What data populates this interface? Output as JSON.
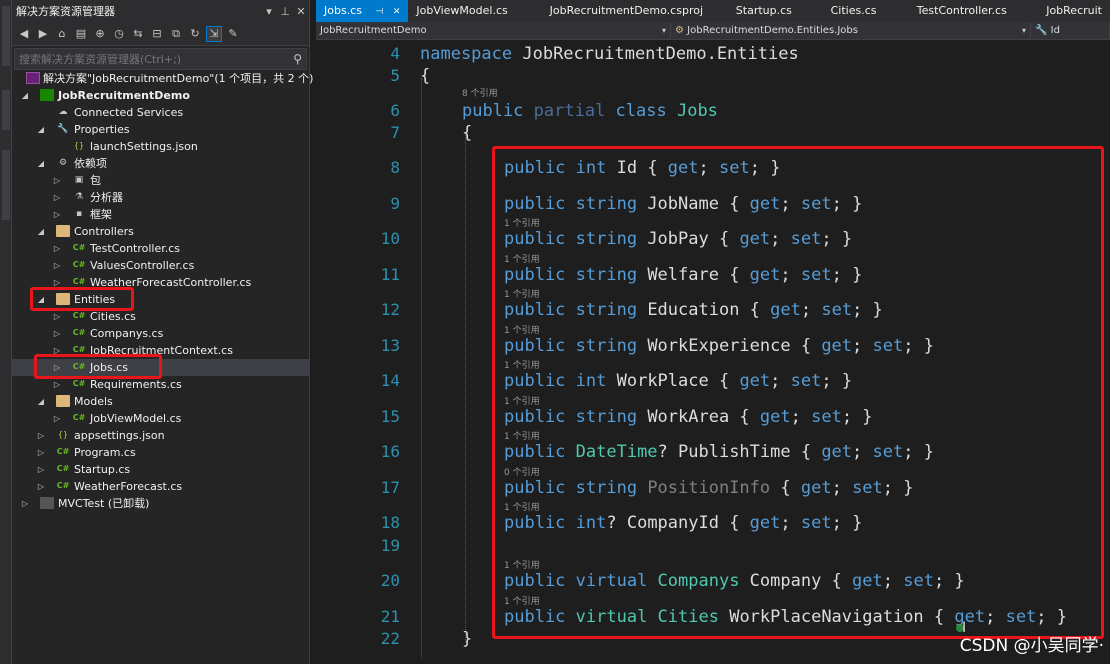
{
  "explorer": {
    "title": "解决方案资源管理器",
    "search_placeholder": "搜索解决方案资源管理器(Ctrl+;)",
    "tree": [
      {
        "label": "解决方案\"JobRecruitmentDemo\"(1 个项目，共 2 个)",
        "icon": "solution-icon"
      },
      {
        "label": "JobRecruitmentDemo",
        "icon": "csharp-project-icon"
      },
      {
        "label": "Connected Services",
        "icon": "connected-services-icon"
      },
      {
        "label": "Properties",
        "icon": "properties-icon"
      },
      {
        "label": "launchSettings.json",
        "icon": "json-file-icon"
      },
      {
        "label": "依赖项",
        "icon": "dependencies-icon"
      },
      {
        "label": "包",
        "icon": "package-icon"
      },
      {
        "label": "分析器",
        "icon": "analyzer-icon"
      },
      {
        "label": "框架",
        "icon": "framework-icon"
      },
      {
        "label": "Controllers",
        "icon": "folder-icon"
      },
      {
        "label": "TestController.cs",
        "icon": "csharp-file-icon"
      },
      {
        "label": "ValuesController.cs",
        "icon": "csharp-file-icon"
      },
      {
        "label": "WeatherForecastController.cs",
        "icon": "csharp-file-icon"
      },
      {
        "label": "Entities",
        "icon": "folder-icon"
      },
      {
        "label": "Cities.cs",
        "icon": "csharp-file-icon"
      },
      {
        "label": "Companys.cs",
        "icon": "csharp-file-icon"
      },
      {
        "label": "JobRecruitmentContext.cs",
        "icon": "csharp-file-icon"
      },
      {
        "label": "Jobs.cs",
        "icon": "csharp-file-icon"
      },
      {
        "label": "Requirements.cs",
        "icon": "csharp-file-icon"
      },
      {
        "label": "Models",
        "icon": "folder-icon"
      },
      {
        "label": "JobViewModel.cs",
        "icon": "csharp-file-icon"
      },
      {
        "label": "appsettings.json",
        "icon": "json-file-icon"
      },
      {
        "label": "Program.cs",
        "icon": "csharp-file-icon"
      },
      {
        "label": "Startup.cs",
        "icon": "csharp-file-icon"
      },
      {
        "label": "WeatherForecast.cs",
        "icon": "csharp-file-icon"
      },
      {
        "label": "MVCTest (已卸载)",
        "icon": "project-icon"
      }
    ]
  },
  "editor": {
    "tabs": [
      "Jobs.cs",
      "JobViewModel.cs",
      "JobRecruitmentDemo.csproj",
      "Startup.cs",
      "Cities.cs",
      "TestController.cs",
      "JobRecruit"
    ],
    "nav_project": "JobRecruitmentDemo",
    "nav_class": "JobRecruitmentDemo.Entities.Jobs",
    "nav_member": "Id",
    "lines": [
      {
        "num": "4",
        "tokens": [
          {
            "t": "namespace ",
            "c": "kw"
          },
          {
            "t": "JobRecruitmentDemo.Entities",
            "c": "pl"
          }
        ]
      },
      {
        "num": "5",
        "tokens": [
          {
            "t": "{",
            "c": "pl"
          }
        ]
      },
      {
        "num": "6",
        "tokens": [
          {
            "t": "public ",
            "c": "kw"
          },
          {
            "t": "partial ",
            "c": "dimkw"
          },
          {
            "t": "class ",
            "c": "kw"
          },
          {
            "t": "Jobs",
            "c": "ty"
          }
        ]
      },
      {
        "num": "7",
        "tokens": [
          {
            "t": "{",
            "c": "pl"
          }
        ]
      },
      {
        "num": "8",
        "tokens": [
          {
            "t": "public ",
            "c": "kw"
          },
          {
            "t": "int ",
            "c": "kw"
          },
          {
            "t": "Id { ",
            "c": "pl"
          },
          {
            "t": "get",
            "c": "kw"
          },
          {
            "t": "; ",
            "c": "pl"
          },
          {
            "t": "set",
            "c": "kw"
          },
          {
            "t": "; }",
            "c": "pl"
          }
        ]
      },
      {
        "num": "9",
        "tokens": [
          {
            "t": "public ",
            "c": "kw"
          },
          {
            "t": "string ",
            "c": "kw"
          },
          {
            "t": "JobName { ",
            "c": "pl"
          },
          {
            "t": "get",
            "c": "kw"
          },
          {
            "t": "; ",
            "c": "pl"
          },
          {
            "t": "set",
            "c": "kw"
          },
          {
            "t": "; }",
            "c": "pl"
          }
        ]
      },
      {
        "num": "10",
        "tokens": [
          {
            "t": "public ",
            "c": "kw"
          },
          {
            "t": "string ",
            "c": "kw"
          },
          {
            "t": "JobPay { ",
            "c": "pl"
          },
          {
            "t": "get",
            "c": "kw"
          },
          {
            "t": "; ",
            "c": "pl"
          },
          {
            "t": "set",
            "c": "kw"
          },
          {
            "t": "; }",
            "c": "pl"
          }
        ]
      },
      {
        "num": "11",
        "tokens": [
          {
            "t": "public ",
            "c": "kw"
          },
          {
            "t": "string ",
            "c": "kw"
          },
          {
            "t": "Welfare { ",
            "c": "pl"
          },
          {
            "t": "get",
            "c": "kw"
          },
          {
            "t": "; ",
            "c": "pl"
          },
          {
            "t": "set",
            "c": "kw"
          },
          {
            "t": "; }",
            "c": "pl"
          }
        ]
      },
      {
        "num": "12",
        "tokens": [
          {
            "t": "public ",
            "c": "kw"
          },
          {
            "t": "string ",
            "c": "kw"
          },
          {
            "t": "Education { ",
            "c": "pl"
          },
          {
            "t": "get",
            "c": "kw"
          },
          {
            "t": "; ",
            "c": "pl"
          },
          {
            "t": "set",
            "c": "kw"
          },
          {
            "t": "; }",
            "c": "pl"
          }
        ]
      },
      {
        "num": "13",
        "tokens": [
          {
            "t": "public ",
            "c": "kw"
          },
          {
            "t": "string ",
            "c": "kw"
          },
          {
            "t": "WorkExperience { ",
            "c": "pl"
          },
          {
            "t": "get",
            "c": "kw"
          },
          {
            "t": "; ",
            "c": "pl"
          },
          {
            "t": "set",
            "c": "kw"
          },
          {
            "t": "; }",
            "c": "pl"
          }
        ]
      },
      {
        "num": "14",
        "tokens": [
          {
            "t": "public ",
            "c": "kw"
          },
          {
            "t": "int ",
            "c": "kw"
          },
          {
            "t": "WorkPlace { ",
            "c": "pl"
          },
          {
            "t": "get",
            "c": "kw"
          },
          {
            "t": "; ",
            "c": "pl"
          },
          {
            "t": "set",
            "c": "kw"
          },
          {
            "t": "; }",
            "c": "pl"
          }
        ]
      },
      {
        "num": "15",
        "tokens": [
          {
            "t": "public ",
            "c": "kw"
          },
          {
            "t": "string ",
            "c": "kw"
          },
          {
            "t": "WorkArea { ",
            "c": "pl"
          },
          {
            "t": "get",
            "c": "kw"
          },
          {
            "t": "; ",
            "c": "pl"
          },
          {
            "t": "set",
            "c": "kw"
          },
          {
            "t": "; }",
            "c": "pl"
          }
        ]
      },
      {
        "num": "16",
        "tokens": [
          {
            "t": "public ",
            "c": "kw"
          },
          {
            "t": "DateTime",
            "c": "ty"
          },
          {
            "t": "? PublishTime { ",
            "c": "pl"
          },
          {
            "t": "get",
            "c": "kw"
          },
          {
            "t": "; ",
            "c": "pl"
          },
          {
            "t": "set",
            "c": "kw"
          },
          {
            "t": "; }",
            "c": "pl"
          }
        ]
      },
      {
        "num": "17",
        "tokens": [
          {
            "t": "public ",
            "c": "kw"
          },
          {
            "t": "string ",
            "c": "kw"
          },
          {
            "t": "PositionInfo ",
            "c": "dim"
          },
          {
            "t": "{ ",
            "c": "pl"
          },
          {
            "t": "get",
            "c": "kw"
          },
          {
            "t": "; ",
            "c": "pl"
          },
          {
            "t": "set",
            "c": "kw"
          },
          {
            "t": "; }",
            "c": "pl"
          }
        ]
      },
      {
        "num": "18",
        "tokens": [
          {
            "t": "public ",
            "c": "kw"
          },
          {
            "t": "int",
            "c": "kw"
          },
          {
            "t": "? CompanyId { ",
            "c": "pl"
          },
          {
            "t": "get",
            "c": "kw"
          },
          {
            "t": "; ",
            "c": "pl"
          },
          {
            "t": "set",
            "c": "kw"
          },
          {
            "t": "; }",
            "c": "pl"
          }
        ]
      },
      {
        "num": "19",
        "tokens": []
      },
      {
        "num": "20",
        "tokens": [
          {
            "t": "public ",
            "c": "kw"
          },
          {
            "t": "virtual ",
            "c": "kw"
          },
          {
            "t": "Companys",
            "c": "ty"
          },
          {
            "t": " Company { ",
            "c": "pl"
          },
          {
            "t": "get",
            "c": "kw"
          },
          {
            "t": "; ",
            "c": "pl"
          },
          {
            "t": "set",
            "c": "kw"
          },
          {
            "t": "; }",
            "c": "pl"
          }
        ]
      },
      {
        "num": "21",
        "tokens": [
          {
            "t": "public ",
            "c": "kw"
          },
          {
            "t": "virtual ",
            "c": "kw"
          },
          {
            "t": "Cities",
            "c": "ty"
          },
          {
            "t": " WorkPlaceNavigation { ",
            "c": "pl"
          },
          {
            "t": "get",
            "c": "kw"
          },
          {
            "t": "; ",
            "c": "pl"
          },
          {
            "t": "set",
            "c": "kw"
          },
          {
            "t": "; }",
            "c": "pl"
          }
        ]
      },
      {
        "num": "22",
        "tokens": [
          {
            "t": "}",
            "c": "pl"
          }
        ]
      }
    ],
    "lens": [
      {
        "text": "8 个引用",
        "before": "6"
      },
      {
        "text": "1 个引用",
        "before": "10"
      },
      {
        "text": "1 个引用",
        "before": "11"
      },
      {
        "text": "1 个引用",
        "before": "12"
      },
      {
        "text": "1 个引用",
        "before": "13"
      },
      {
        "text": "1 个引用",
        "before": "14"
      },
      {
        "text": "1 个引用",
        "before": "15"
      },
      {
        "text": "1 个引用",
        "before": "16"
      },
      {
        "text": "0 个引用",
        "before": "17"
      },
      {
        "text": "1 个引用",
        "before": "18"
      },
      {
        "text": "1 个引用",
        "before": "20"
      },
      {
        "text": "1 个引用",
        "before": "21"
      }
    ]
  },
  "watermark": "CSDN @小吴同学·",
  "colors": {
    "accent": "#007acc",
    "highlight": "#e8151b",
    "keyword": "#569cd6",
    "type": "#4ec9b0",
    "line_number": "#2b91af"
  }
}
